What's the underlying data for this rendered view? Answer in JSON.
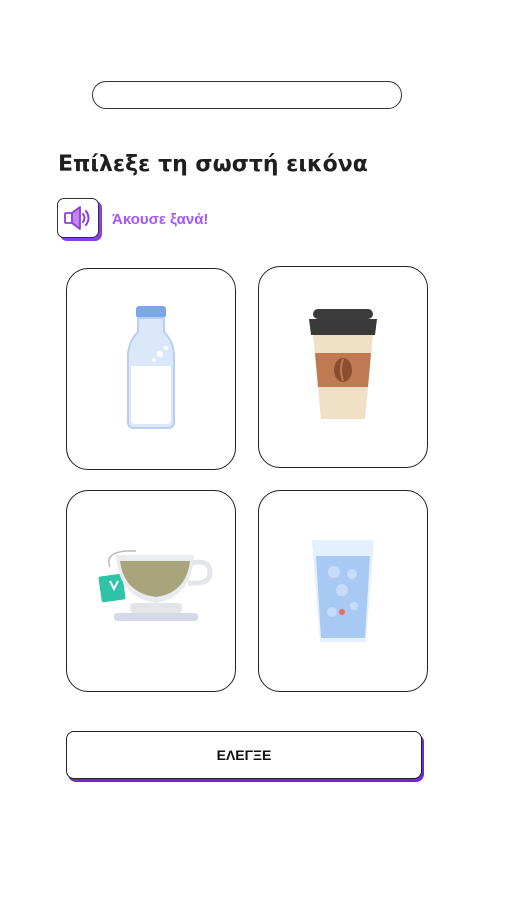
{
  "progress": {
    "value": 0
  },
  "prompt": {
    "title": "Επίλεξε τη σωστή εικόνα"
  },
  "audio": {
    "icon": "speaker-icon",
    "label": "Άκουσε ξανά!"
  },
  "options": [
    {
      "icon": "milk-bottle-icon"
    },
    {
      "icon": "coffee-cup-icon"
    },
    {
      "icon": "tea-cup-icon"
    },
    {
      "icon": "water-glass-icon"
    }
  ],
  "actions": {
    "check_label": "ΕΛΕΓΞΕ"
  },
  "colors": {
    "accent": "#a855f7",
    "shadow": "#6d28d9"
  }
}
